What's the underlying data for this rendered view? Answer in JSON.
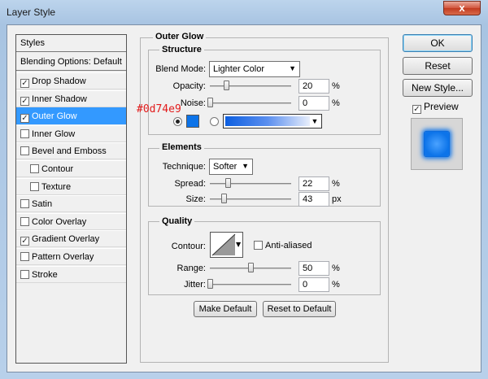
{
  "window": {
    "title": "Layer Style",
    "close_glyph": "x"
  },
  "styles_list": {
    "header": "Styles",
    "blending": "Blending Options: Default",
    "items": [
      {
        "label": "Drop Shadow",
        "checked": true,
        "sub": false,
        "selected": false
      },
      {
        "label": "Inner Shadow",
        "checked": true,
        "sub": false,
        "selected": false
      },
      {
        "label": "Outer Glow",
        "checked": true,
        "sub": false,
        "selected": true
      },
      {
        "label": "Inner Glow",
        "checked": false,
        "sub": false,
        "selected": false
      },
      {
        "label": "Bevel and Emboss",
        "checked": false,
        "sub": false,
        "selected": false
      },
      {
        "label": "Contour",
        "checked": false,
        "sub": true,
        "selected": false
      },
      {
        "label": "Texture",
        "checked": false,
        "sub": true,
        "selected": false
      },
      {
        "label": "Satin",
        "checked": false,
        "sub": false,
        "selected": false
      },
      {
        "label": "Color Overlay",
        "checked": false,
        "sub": false,
        "selected": false
      },
      {
        "label": "Gradient Overlay",
        "checked": true,
        "sub": false,
        "selected": false
      },
      {
        "label": "Pattern Overlay",
        "checked": false,
        "sub": false,
        "selected": false
      },
      {
        "label": "Stroke",
        "checked": false,
        "sub": false,
        "selected": false
      }
    ]
  },
  "outer_glow": {
    "panel_title": "Outer Glow",
    "structure": {
      "title": "Structure",
      "blend_mode_label": "Blend Mode:",
      "blend_mode_value": "Lighter Color",
      "opacity_label": "Opacity:",
      "opacity_value": "20",
      "opacity_unit": "%",
      "noise_label": "Noise:",
      "noise_value": "0",
      "noise_unit": "%",
      "color_annotation": "#0d74e9",
      "glow_color": "#0d74e9"
    },
    "elements": {
      "title": "Elements",
      "technique_label": "Technique:",
      "technique_value": "Softer",
      "spread_label": "Spread:",
      "spread_value": "22",
      "spread_unit": "%",
      "size_label": "Size:",
      "size_value": "43",
      "size_unit": "px"
    },
    "quality": {
      "title": "Quality",
      "contour_label": "Contour:",
      "anti_aliased_label": "Anti-aliased",
      "range_label": "Range:",
      "range_value": "50",
      "range_unit": "%",
      "jitter_label": "Jitter:",
      "jitter_value": "0",
      "jitter_unit": "%"
    },
    "make_default": "Make Default",
    "reset_default": "Reset to Default"
  },
  "actions": {
    "ok": "OK",
    "reset": "Reset",
    "new_style": "New Style...",
    "preview_label": "Preview"
  }
}
